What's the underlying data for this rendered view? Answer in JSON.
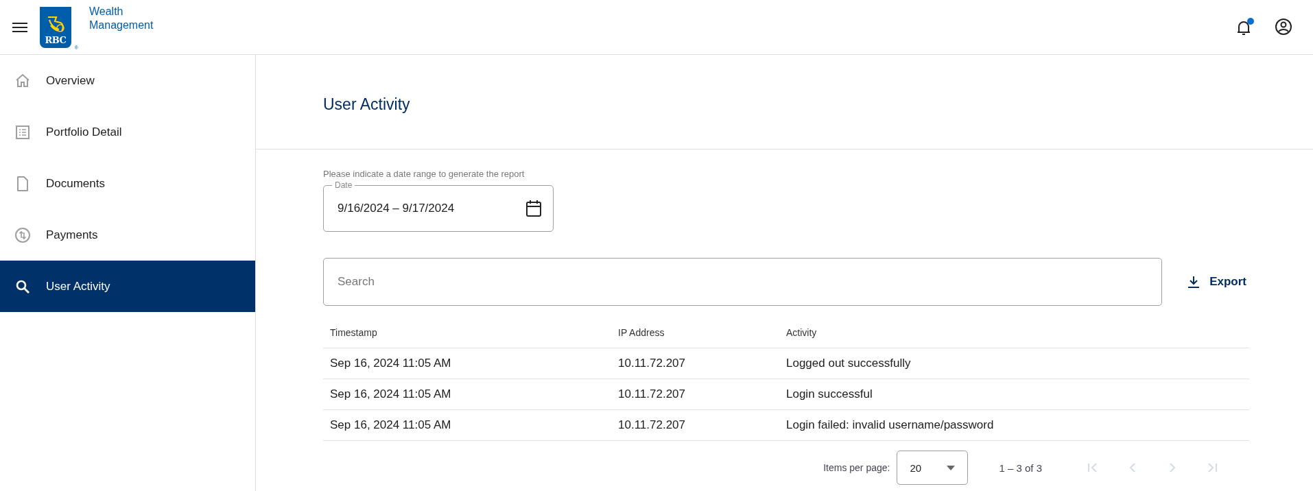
{
  "header": {
    "logo_text": "RBC",
    "registered_mark": "®",
    "brand_lines": [
      "Wealth",
      "Management"
    ],
    "notifications": {
      "unread": true
    }
  },
  "sidebar": {
    "items": [
      {
        "label": "Overview",
        "selected": false
      },
      {
        "label": "Portfolio Detail",
        "selected": false
      },
      {
        "label": "Documents",
        "selected": false
      },
      {
        "label": "Payments",
        "selected": false
      },
      {
        "label": "User Activity",
        "selected": true
      }
    ]
  },
  "page": {
    "title": "User Activity"
  },
  "date_range": {
    "hint": "Please indicate a date range to generate the report",
    "label": "Date",
    "value": "9/16/2024 – 9/17/2024"
  },
  "search": {
    "placeholder": "Search"
  },
  "export_button": {
    "label": "Export"
  },
  "table": {
    "columns": [
      "Timestamp",
      "IP Address",
      "Activity"
    ],
    "rows": [
      [
        "Sep 16, 2024 11:05 AM",
        "10.11.72.207",
        "Logged out successfully"
      ],
      [
        "Sep 16, 2024 11:05 AM",
        "10.11.72.207",
        "Login successful"
      ],
      [
        "Sep 16, 2024 11:05 AM",
        "10.11.72.207",
        "Login failed: invalid username/password"
      ]
    ]
  },
  "pagination": {
    "items_per_page_label": "Items per page:",
    "page_size": "20",
    "range": "1 – 3 of 3",
    "buttons": [
      {
        "kind": "first",
        "disabled": true
      },
      {
        "kind": "previous",
        "disabled": true
      },
      {
        "kind": "next",
        "disabled": true
      },
      {
        "kind": "last",
        "disabled": true
      }
    ]
  }
}
